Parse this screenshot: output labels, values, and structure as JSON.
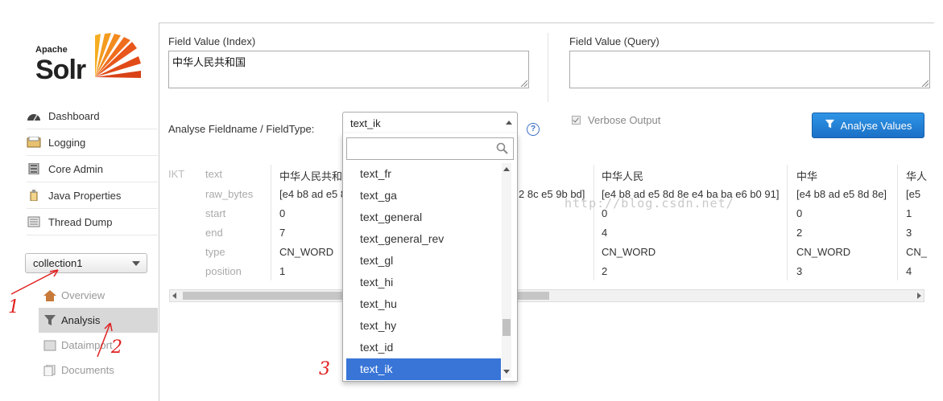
{
  "logo": {
    "apache": "Apache",
    "solr": "Solr"
  },
  "nav": [
    {
      "label": "Dashboard",
      "icon": "dashboard-icon"
    },
    {
      "label": "Logging",
      "icon": "logging-icon"
    },
    {
      "label": "Core Admin",
      "icon": "core-admin-icon"
    },
    {
      "label": "Java Properties",
      "icon": "java-icon"
    },
    {
      "label": "Thread Dump",
      "icon": "thread-dump-icon"
    }
  ],
  "core_selector": {
    "value": "collection1"
  },
  "core_nav": [
    {
      "label": "Overview",
      "icon": "home-icon",
      "active": false
    },
    {
      "label": "Analysis",
      "icon": "funnel-icon",
      "active": true
    },
    {
      "label": "Dataimport",
      "icon": "dataimport-icon",
      "active": false
    },
    {
      "label": "Documents",
      "icon": "documents-icon",
      "active": false
    }
  ],
  "analysis": {
    "index_label": "Field Value (Index)",
    "index_value": "中华人民共和国",
    "query_label": "Field Value (Query)",
    "query_value": "",
    "fieldtype_label": "Analyse Fieldname / FieldType:",
    "fieldtype_value": "text_ik",
    "help": "?",
    "verbose_label": "Verbose Output",
    "verbose_checked": true,
    "analyse_button": "Analyse Values"
  },
  "dropdown": {
    "search_placeholder": "",
    "options": [
      "text_fr",
      "text_ga",
      "text_general",
      "text_general_rev",
      "text_gl",
      "text_hi",
      "text_hu",
      "text_hy",
      "text_id",
      "text_ik"
    ],
    "selected": "text_ik"
  },
  "result_table": {
    "tokenizer": "IKT",
    "row_labels": [
      "text",
      "raw_bytes",
      "start",
      "end",
      "type",
      "position"
    ],
    "columns": [
      {
        "text": "中华人民共和国",
        "raw_bytes": "[e4 b8 ad e5 8d 8e e4 ba ba e6 b0 91 e5 85 b1 e5 92 8c e5 9b bd]",
        "start": "0",
        "end": "7",
        "type": "CN_WORD",
        "position": "1"
      },
      {
        "text": "",
        "raw_bytes": "2 8c e5 9b bd]",
        "start": "",
        "end": "",
        "type": "",
        "position": ""
      },
      {
        "text": "中华人民",
        "raw_bytes": "[e4 b8 ad e5 8d 8e e4 ba ba e6 b0 91]",
        "start": "0",
        "end": "4",
        "type": "CN_WORD",
        "position": "2"
      },
      {
        "text": "中华",
        "raw_bytes": "[e4 b8 ad e5 8d 8e]",
        "start": "0",
        "end": "2",
        "type": "CN_WORD",
        "position": "3"
      },
      {
        "text": "华人",
        "raw_bytes": "[e5",
        "start": "1",
        "end": "3",
        "type": "CN_",
        "position": "4"
      }
    ]
  },
  "watermark": "http://blog.csdn.net/",
  "annotations": [
    "1",
    "2",
    "3"
  ],
  "colors": {
    "accent": "#1b70c6",
    "selected": "#3875d7",
    "annotation": "#e02020"
  }
}
